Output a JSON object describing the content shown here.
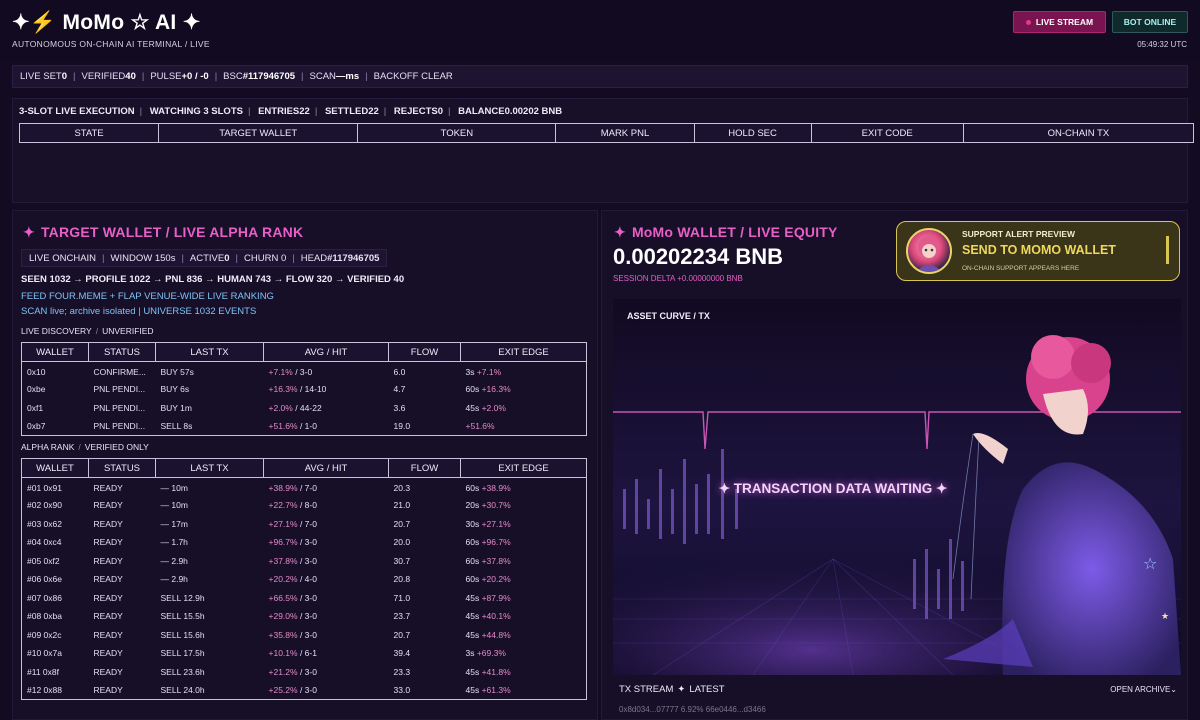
{
  "header": {
    "brand": "MoMo ☆ AI ✦",
    "subtitle": "AUTONOMOUS ON-CHAIN AI TERMINAL / LIVE",
    "live_stream_label": "LIVE STREAM",
    "bot_status_label": "BOT ONLINE",
    "clock": "05:49:32 UTC"
  },
  "status_bar": {
    "live_set_label": "LIVE SET",
    "live_set_value": "0",
    "verified_label": "VERIFIED",
    "verified_value": "40",
    "pulse_label": "PULSE",
    "pulse_value": "+0 / -0",
    "bsc_label": "BSC",
    "bsc_value": "#117946705",
    "scan_label": "SCAN",
    "scan_value": "—ms",
    "backoff": "BACKOFF CLEAR"
  },
  "execution": {
    "title": "3-SLOT LIVE EXECUTION",
    "watching": "WATCHING 3 SLOTS",
    "entries": "ENTRIES22",
    "settled": "SETTLED22",
    "rejects": "REJECTS0",
    "balance": "BALANCE0.00202 BNB",
    "columns": [
      "STATE",
      "TARGET WALLET",
      "TOKEN",
      "MARK PNL",
      "HOLD SEC",
      "EXIT CODE",
      "ON-CHAIN TX"
    ]
  },
  "target": {
    "title": "TARGET WALLET / LIVE ALPHA RANK",
    "meta": {
      "onchain": "LIVE ONCHAIN",
      "window": "WINDOW 150s",
      "active_label": "ACTIVE",
      "active_value": "0",
      "churn": "CHURN 0",
      "head_label": "HEAD",
      "head_value": "#117946705"
    },
    "funnel": "SEEN 1032 → PROFILE 1022 → PNL 836 → HUMAN 743 → FLOW 320 → VERIFIED 40",
    "feed": "FEED FOUR.MEME + FLAP VENUE-WIDE LIVE RANKING",
    "scan": "SCAN live; archive isolated | UNIVERSE 1032 EVENTS",
    "discovery_label": "LIVE DISCOVERY",
    "discovery_tag": "UNVERIFIED",
    "alpha_label": "ALPHA RANK",
    "alpha_tag": "VERIFIED ONLY",
    "columns": [
      "WALLET",
      "STATUS",
      "LAST TX",
      "AVG / HIT",
      "FLOW",
      "EXIT EDGE"
    ],
    "discovery_rows": [
      {
        "wallet": "0x10",
        "status": "CONFIRME...",
        "last_tx": "BUY 57s",
        "avg": "+7.1%",
        "hit": " / 3-0",
        "flow": "6.0",
        "exit_t": "3s ",
        "exit_v": "+7.1%"
      },
      {
        "wallet": "0xbe",
        "status": "PNL PENDI...",
        "last_tx": "BUY 6s",
        "avg": "+16.3%",
        "hit": " / 14-10",
        "flow": "4.7",
        "exit_t": "60s ",
        "exit_v": "+16.3%"
      },
      {
        "wallet": "0xf1",
        "status": "PNL PENDI...",
        "last_tx": "BUY 1m",
        "avg": "+2.0%",
        "hit": " / 44-22",
        "flow": "3.6",
        "exit_t": "45s ",
        "exit_v": "+2.0%"
      },
      {
        "wallet": "0xb7",
        "status": "PNL PENDI...",
        "last_tx": "SELL 8s",
        "avg": "+51.6%",
        "hit": " / 1-0",
        "flow": "19.0",
        "exit_t": "",
        "exit_v": "+51.6%"
      }
    ],
    "alpha_rows": [
      {
        "wallet": "#01 0x91",
        "status": "READY",
        "last_tx": "— 10m",
        "avg": "+38.9%",
        "hit": " / 7-0",
        "flow": "20.3",
        "exit_t": "60s ",
        "exit_v": "+38.9%"
      },
      {
        "wallet": "#02 0x90",
        "status": "READY",
        "last_tx": "— 10m",
        "avg": "+22.7%",
        "hit": " / 8-0",
        "flow": "21.0",
        "exit_t": "20s ",
        "exit_v": "+30.7%"
      },
      {
        "wallet": "#03 0x62",
        "status": "READY",
        "last_tx": "— 17m",
        "avg": "+27.1%",
        "hit": " / 7-0",
        "flow": "20.7",
        "exit_t": "30s ",
        "exit_v": "+27.1%"
      },
      {
        "wallet": "#04 0xc4",
        "status": "READY",
        "last_tx": "— 1.7h",
        "avg": "+96.7%",
        "hit": " / 3-0",
        "flow": "20.0",
        "exit_t": "60s ",
        "exit_v": "+96.7%"
      },
      {
        "wallet": "#05 0xf2",
        "status": "READY",
        "last_tx": "— 2.9h",
        "avg": "+37.8%",
        "hit": " / 3-0",
        "flow": "30.7",
        "exit_t": "60s ",
        "exit_v": "+37.8%"
      },
      {
        "wallet": "#06 0x6e",
        "status": "READY",
        "last_tx": "— 2.9h",
        "avg": "+20.2%",
        "hit": " / 4-0",
        "flow": "20.8",
        "exit_t": "60s ",
        "exit_v": "+20.2%"
      },
      {
        "wallet": "#07 0x86",
        "status": "READY",
        "last_tx": "SELL 12.9h",
        "avg": "+66.5%",
        "hit": " / 3-0",
        "flow": "71.0",
        "exit_t": "45s ",
        "exit_v": "+87.9%"
      },
      {
        "wallet": "#08 0xba",
        "status": "READY",
        "last_tx": "SELL 15.5h",
        "avg": "+29.0%",
        "hit": " / 3-0",
        "flow": "23.7",
        "exit_t": "45s ",
        "exit_v": "+40.1%"
      },
      {
        "wallet": "#09 0x2c",
        "status": "READY",
        "last_tx": "SELL 15.6h",
        "avg": "+35.8%",
        "hit": " / 3-0",
        "flow": "20.7",
        "exit_t": "45s ",
        "exit_v": "+44.8%"
      },
      {
        "wallet": "#10 0x7a",
        "status": "READY",
        "last_tx": "SELL 17.5h",
        "avg": "+10.1%",
        "hit": " / 6-1",
        "flow": "39.4",
        "exit_t": "3s ",
        "exit_v": "+69.3%"
      },
      {
        "wallet": "#11 0x8f",
        "status": "READY",
        "last_tx": "SELL 23.6h",
        "avg": "+21.2%",
        "hit": " / 3-0",
        "flow": "23.3",
        "exit_t": "45s ",
        "exit_v": "+41.8%"
      },
      {
        "wallet": "#12 0x88",
        "status": "READY",
        "last_tx": "SELL 24.0h",
        "avg": "+25.2%",
        "hit": " / 3-0",
        "flow": "33.0",
        "exit_t": "45s ",
        "exit_v": "+61.3%"
      }
    ]
  },
  "wallet": {
    "title": "MoMo WALLET / LIVE EQUITY",
    "equity": "0.00202234 BNB",
    "session_delta": "SESSION DELTA +0.00000000 BNB",
    "alert": {
      "label": "SUPPORT ALERT PREVIEW",
      "headline": "SEND TO MOMO WALLET",
      "note": "ON-CHAIN SUPPORT APPEARS HERE"
    },
    "curve_label": "ASSET CURVE / TX",
    "waiting": "✦ TRANSACTION DATA WAITING ✦",
    "stream_label": "TX STREAM",
    "stream_tag": "LATEST",
    "archive_label": "OPEN ARCHIVE⌄",
    "tx_preview": "0x8d034...07777   6.92%   66e0446...d3466"
  },
  "colors": {
    "background": "#130b22",
    "panel": "#170f28",
    "accent_pink": "#e75fc7",
    "accent_blue": "#7fc3f5",
    "alert_gold": "#efd85c",
    "online_teal": "#a7f0ef"
  }
}
